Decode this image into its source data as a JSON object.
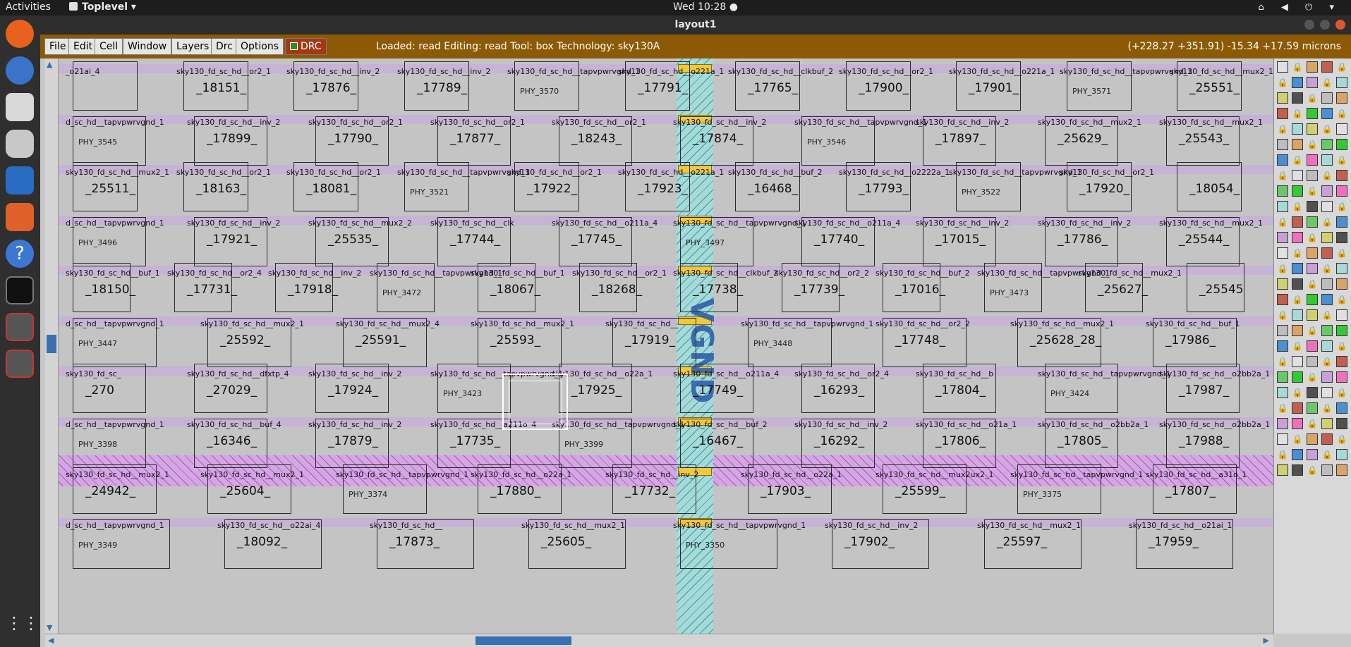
{
  "topbar": {
    "activities": "Activities",
    "app_name": "Toplevel",
    "clock": "Wed 10:28 ●"
  },
  "window": {
    "title": "layout1"
  },
  "menu": {
    "items": [
      "File",
      "Edit",
      "Cell",
      "Window",
      "Layers",
      "Drc",
      "Options"
    ],
    "drc_toggle": "DRC",
    "status": "Loaded: read  Editing: read  Tool: box   Technology: sky130A",
    "coords": "(+228.27 +351.91) -15.34 +17.59 microns"
  },
  "layout": {
    "vertical_text": "VGND",
    "rows": [
      {
        "cells": [
          {
            "t": "_o21ai_4",
            "n": ""
          },
          {
            "t": "sky130_fd_sc_hd__or2_1",
            "n": "_18151_"
          },
          {
            "t": "sky130_fd_sc_hd__inv_2",
            "n": "_17876_"
          },
          {
            "t": "sky130_fd_sc_hd__inv_2",
            "n": "_17789_"
          },
          {
            "t": "sky130_fd_sc_hd__tapvpwrvgnd_1",
            "n": "PHY_3570"
          },
          {
            "t": "sky130_fd_sc_hd__o221a_1",
            "n": "_17791_"
          },
          {
            "t": "sky130_fd_sc_hd__clkbuf_2",
            "n": "_17765_"
          },
          {
            "t": "sky130_fd_sc_hd__or2_1",
            "n": "_17900_"
          },
          {
            "t": "sky130_fd_sc_hd__o221a_1",
            "n": "_17901_"
          },
          {
            "t": "sky130_fd_sc_hd__tapvpwrvgnd_1",
            "n": "PHY_3571"
          },
          {
            "t": "sky130_fd_sc_hd__mux2_1",
            "n": "_25551_"
          }
        ]
      },
      {
        "cells": [
          {
            "t": "d_sc_hd__tapvpwrvgnd_1",
            "n": "PHY_3545"
          },
          {
            "t": "sky130_fd_sc_hd__inv_2",
            "n": "_17899_"
          },
          {
            "t": "sky130_fd_sc_hd__or2_1",
            "n": "_17790_"
          },
          {
            "t": "sky130_fd_sc_hd__or2_1",
            "n": "_17877_"
          },
          {
            "t": "sky130_fd_sc_hd__or2_1",
            "n": "_18243_"
          },
          {
            "t": "sky130_fd_sc_hd__inv_2",
            "n": "_17874_"
          },
          {
            "t": "sky130_fd_sc_hd__tapvpwrvgnd_1",
            "n": "PHY_3546"
          },
          {
            "t": "sky130_fd_sc_hd__inv_2",
            "n": "_17897_"
          },
          {
            "t": "sky130_fd_sc_hd__mux2_1",
            "n": "_25629_"
          },
          {
            "t": "sky130_fd_sc_hd__mux2_1",
            "n": "_25543_"
          }
        ]
      },
      {
        "cells": [
          {
            "t": "sky130_fd_sc_hd__mux2_1",
            "n": "_25511_"
          },
          {
            "t": "sky130_fd_sc_hd__or2_1",
            "n": "_18163_"
          },
          {
            "t": "sky130_fd_sc_hd__or2_1",
            "n": "_18081_"
          },
          {
            "t": "sky130_fd_sc_hd__tapvpwrvgnd_1",
            "n": "PHY_3521"
          },
          {
            "t": "sky130_fd_sc_hd__or2_1",
            "n": "_17922_"
          },
          {
            "t": "sky130_fd_sc_hd__o221a_1",
            "n": "_17923_"
          },
          {
            "t": "sky130_fd_sc_hd__buf_2",
            "n": "_16468_"
          },
          {
            "t": "sky130_fd_sc_hd__o2222a_1",
            "n": "_17793_"
          },
          {
            "t": "sky130_fd_sc_hd__tapvpwrvgnd_1",
            "n": "PHY_3522"
          },
          {
            "t": "sky130_fd_sc_hd__or2_1",
            "n": "_17920_"
          },
          {
            "t": "",
            "n": "_18054_"
          }
        ]
      },
      {
        "cells": [
          {
            "t": "d_sc_hd__tapvpwrvgnd_1",
            "n": "PHY_3496"
          },
          {
            "t": "sky130_fd_sc_hd__inv_2",
            "n": "_17921_"
          },
          {
            "t": "sky130_fd_sc_hd__mux2_2",
            "n": "_25535_"
          },
          {
            "t": "sky130_fd_sc_hd__clk",
            "n": "_17744_"
          },
          {
            "t": "sky130_fd_sc_hd__o211a_4",
            "n": "_17745_"
          },
          {
            "t": "sky130_fd_sc_hd__tapvpwrvgnd_1",
            "n": "PHY_3497"
          },
          {
            "t": "sky130_fd_sc_hd__o211a_4",
            "n": "_17740_"
          },
          {
            "t": "sky130_fd_sc_hd__inv_2",
            "n": "_17015_"
          },
          {
            "t": "sky130_fd_sc_hd__inv_2",
            "n": "_17786_"
          },
          {
            "t": "sky130_fd_sc_hd__mux2_1",
            "n": "_25544_"
          }
        ]
      },
      {
        "cells": [
          {
            "t": "sky130_fd_sc_hd__buf_1",
            "n": "_18150_"
          },
          {
            "t": "sky130_fd_sc_hd__or2_4",
            "n": "_17731_"
          },
          {
            "t": "sky130_fd_sc_hd__inv_2",
            "n": "_17918_"
          },
          {
            "t": "sky130_fd_sc_hd__tapvpwrvgnd_1",
            "n": "PHY_3472"
          },
          {
            "t": "sky130_fd_sc_hd__buf_1",
            "n": "_18067_"
          },
          {
            "t": "sky130_fd_sc_hd__or2_1",
            "n": "_18268_"
          },
          {
            "t": "sky130_fd_sc_hd__clkbuf_2",
            "n": "_17738_"
          },
          {
            "t": "sky130_fd_sc_hd__or2_2",
            "n": "_17739_"
          },
          {
            "t": "sky130_fd_sc_hd__buf_2",
            "n": "_17016_"
          },
          {
            "t": "sky130_fd_sc_hd__tapvpwrvgnd_1",
            "n": "PHY_3473"
          },
          {
            "t": "sky130_fd_sc_hd__mux2_1",
            "n": "_25627_"
          },
          {
            "t": "",
            "n": "_25545"
          }
        ]
      },
      {
        "cells": [
          {
            "t": "d_sc_hd__tapvpwrvgnd_1",
            "n": "PHY_3447"
          },
          {
            "t": "sky130_fd_sc_hd__mux2_1",
            "n": "_25592_"
          },
          {
            "t": "sky130_fd_sc_hd__mux2_4",
            "n": "_25591_"
          },
          {
            "t": "sky130_fd_sc_hd__mux2_1",
            "n": "_25593_"
          },
          {
            "t": "sky130_fd_sc_hd__",
            "n": "_17919_"
          },
          {
            "t": "sky130_fd_sc_hd__tapvpwrvgnd_1",
            "n": "PHY_3448"
          },
          {
            "t": "sky130_fd_sc_hd__or2_2",
            "n": "_17748_"
          },
          {
            "t": "sky130_fd_sc_hd__mux2_1",
            "n": "_25628_28_"
          },
          {
            "t": "sky130_fd_sc_hd__buf_1",
            "n": "_17986_"
          }
        ]
      },
      {
        "cells": [
          {
            "t": "sky130_fd_sc_",
            "n": "_270"
          },
          {
            "t": "sky130_fd_sc_hd__dfxtp_4",
            "n": "_27029_"
          },
          {
            "t": "sky130_fd_sc_hd__inv_2",
            "n": "_17924_"
          },
          {
            "t": "sky130_fd_sc_hd__tapvpwrvgnd_1",
            "n": "PHY_3423"
          },
          {
            "t": "sky130_fd_sc_hd__o22a_1",
            "n": "_17925_"
          },
          {
            "t": "sky130_fd_sc_hd__o211a_4",
            "n": "_17749_"
          },
          {
            "t": "sky130_fd_sc_hd__or2_4",
            "n": "_16293_"
          },
          {
            "t": "sky130_fd_sc_hd__b",
            "n": "_17804_"
          },
          {
            "t": "sky130_fd_sc_hd__tapvpwrvgnd_1",
            "n": "PHY_3424"
          },
          {
            "t": "sky130_fd_sc_hd__o2bb2a_1",
            "n": "_17987_"
          }
        ]
      },
      {
        "cells": [
          {
            "t": "d_sc_hd__tapvpwrvgnd_1",
            "n": "PHY_3398"
          },
          {
            "t": "sky130_fd_sc_hd__buf_4",
            "n": "_16346_"
          },
          {
            "t": "sky130_fd_sc_hd__inv_2",
            "n": "_17879_"
          },
          {
            "t": "sky130_fd_sc_hd__a211o_4",
            "n": "_17735_"
          },
          {
            "t": "sky130_fd_sc_hd__tapvpwrvgnd_1",
            "n": "PHY_3399"
          },
          {
            "t": "sky130_fd_sc_hd__buf_2",
            "n": "_16467_"
          },
          {
            "t": "sky130_fd_sc_hd__inv_2",
            "n": "_16292_"
          },
          {
            "t": "sky130_fd_sc_hd__o21a_1",
            "n": "_17806_"
          },
          {
            "t": "sky130_fd_sc_hd__o2bb2a_1",
            "n": "_17805_"
          },
          {
            "t": "sky130_fd_sc_hd__o2bb2a_1",
            "n": "_17988_"
          }
        ]
      },
      {
        "cells": [
          {
            "t": "sky130_fd_sc_hd__mux2_1",
            "n": "_24942_"
          },
          {
            "t": "sky130_fd_sc_hd__mux2_1",
            "n": "_25604_"
          },
          {
            "t": "sky130_fd_sc_hd__tapvpwrvgnd_1",
            "n": "PHY_3374"
          },
          {
            "t": "sky130_fd_sc_hd__o22a_1",
            "n": "_17880_"
          },
          {
            "t": "sky130_fd_sc_hd__inv_2",
            "n": "_17732_"
          },
          {
            "t": "sky130_fd_sc_hd__o22a_1",
            "n": "_17903_"
          },
          {
            "t": "sky130_fd_sc_hd__mux2ux2_1",
            "n": "_25599_"
          },
          {
            "t": "sky130_fd_sc_hd__tapvpwrvgnd_1",
            "n": "PHY_3375"
          },
          {
            "t": "sky130_fd_sc_hd__a31o_1",
            "n": "_17807_"
          }
        ]
      },
      {
        "cells": [
          {
            "t": "d_sc_hd__tapvpwrvgnd_1",
            "n": "PHY_3349"
          },
          {
            "t": "sky130_fd_sc_hd__o22ai_4",
            "n": "_18092_"
          },
          {
            "t": "sky130_fd_sc_hd__",
            "n": "_17873_"
          },
          {
            "t": "sky130_fd_sc_hd__mux2_1",
            "n": "_25605_"
          },
          {
            "t": "sky130_fd_sc_hd__tapvpwrvgnd_1",
            "n": "PHY_3350"
          },
          {
            "t": "sky130_fd_sc_hd__inv_2",
            "n": "_17902_"
          },
          {
            "t": "sky130_fd_sc_hd__mux2_1",
            "n": "_25597_"
          },
          {
            "t": "sky130_fd_sc_hd__o21ai_1",
            "n": "_17959_"
          }
        ]
      }
    ]
  },
  "colors": {
    "menubar": "#8c5a05",
    "rail": "#c7b3d6",
    "vgnd": "#2ea0a0",
    "select": "#ffffff"
  }
}
